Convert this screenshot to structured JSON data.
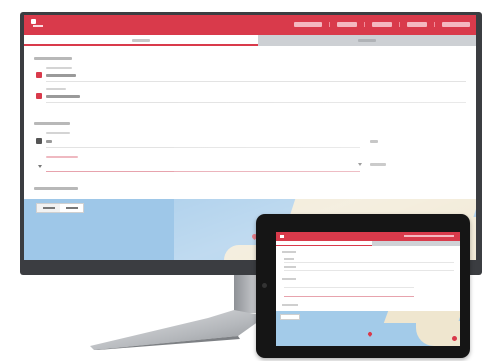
{
  "app": {
    "title": "",
    "accent_color": "#d93a4b",
    "nav_items": [
      "",
      "",
      "",
      "",
      ""
    ],
    "tabs": [
      {
        "label": "",
        "active": true
      },
      {
        "label": "",
        "active": false
      }
    ]
  },
  "form": {
    "section1": {
      "title": "",
      "fields": [
        {
          "label": "",
          "value": "",
          "icon": "pin-icon"
        },
        {
          "label": "",
          "value": "",
          "icon": "calendar-icon"
        }
      ]
    },
    "section2": {
      "title": "",
      "fields": [
        {
          "label": "",
          "value": "",
          "unit": "",
          "icon": "weight-icon"
        },
        {
          "label": "",
          "value": "",
          "unit": "",
          "icon": "dropdown-icon",
          "error": true
        }
      ]
    },
    "section3": {
      "title": "",
      "map_toggle": [
        "",
        ""
      ]
    }
  },
  "devices": [
    "desktop-monitor",
    "tablet"
  ]
}
